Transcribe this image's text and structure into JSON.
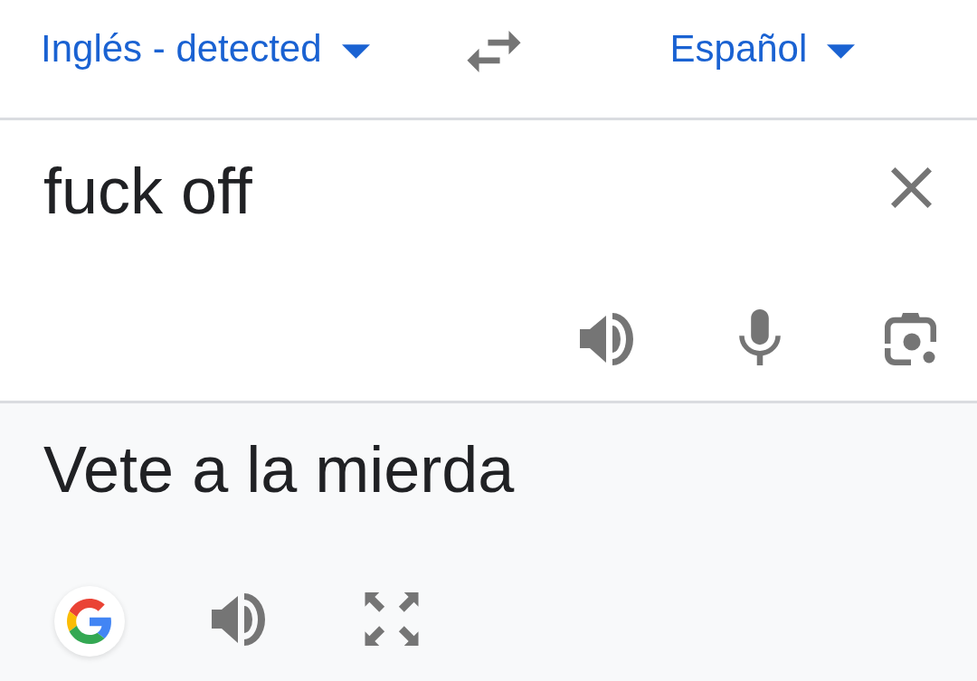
{
  "language_bar": {
    "source_language": {
      "label": "Inglés - detected"
    },
    "target_language": {
      "label": "Español"
    }
  },
  "source": {
    "value": "fuck off"
  },
  "translation": {
    "text": "Vete a la mierda"
  }
}
